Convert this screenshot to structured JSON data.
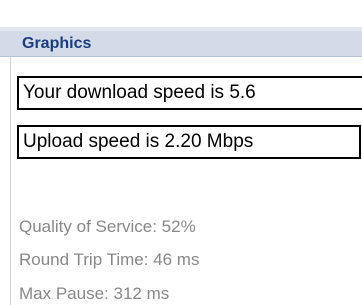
{
  "panel": {
    "title": "Graphics"
  },
  "results": {
    "download_text": "Your download speed is 5.6",
    "upload_text": "Upload speed is 2.20 Mbps"
  },
  "stats": {
    "quality_of_service": "Quality of Service: 52%",
    "round_trip_time": "Round Trip Time: 46 ms",
    "max_pause": "Max Pause: 312 ms"
  },
  "colors": {
    "header_background": "#d3dbe9",
    "header_text": "#1b3d7e",
    "stat_text": "#888888"
  }
}
